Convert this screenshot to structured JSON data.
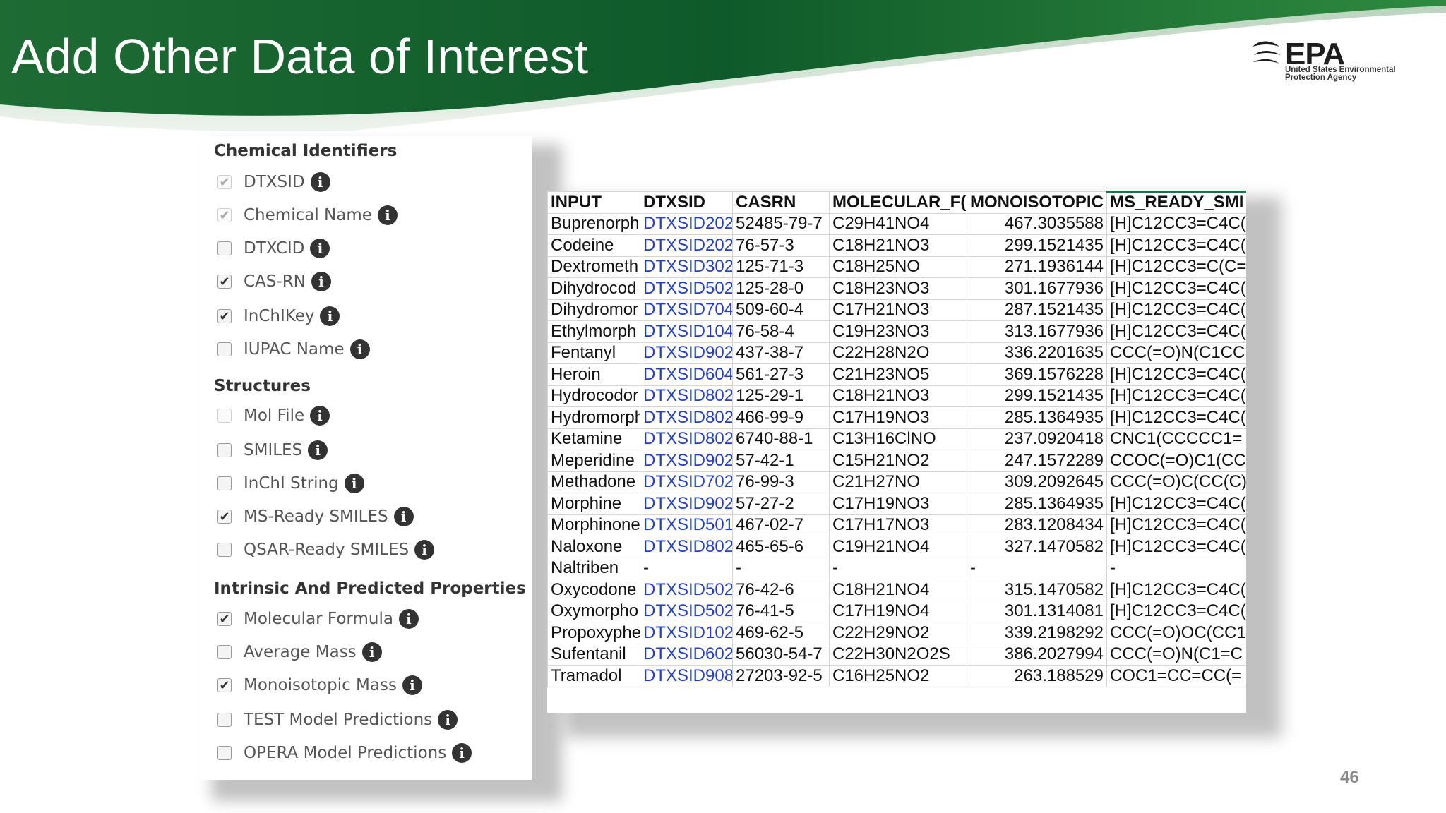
{
  "slide": {
    "title": "Add Other Data of Interest",
    "page_number": "46"
  },
  "logo": {
    "text": "EPA",
    "subtitle": "United States Environmental Protection Agency"
  },
  "panel": {
    "sections": [
      {
        "header": "Chemical Identifiers",
        "options": [
          {
            "label": "DTXSID",
            "checked": true,
            "disabled": true
          },
          {
            "label": "Chemical Name",
            "checked": true,
            "disabled": true
          },
          {
            "label": "DTXCID",
            "checked": false,
            "disabled": false
          },
          {
            "label": "CAS-RN",
            "checked": true,
            "disabled": false
          },
          {
            "label": "InChIKey",
            "checked": true,
            "disabled": false
          },
          {
            "label": "IUPAC Name",
            "checked": false,
            "disabled": false
          }
        ]
      },
      {
        "header": "Structures",
        "options": [
          {
            "label": "Mol File",
            "checked": false,
            "disabled": true
          },
          {
            "label": "SMILES",
            "checked": false,
            "disabled": false
          },
          {
            "label": "InChI String",
            "checked": false,
            "disabled": false
          },
          {
            "label": "MS-Ready SMILES",
            "checked": true,
            "disabled": false
          },
          {
            "label": "QSAR-Ready SMILES",
            "checked": false,
            "disabled": false
          }
        ]
      },
      {
        "header": "Intrinsic And Predicted Properties",
        "options": [
          {
            "label": "Molecular Formula",
            "checked": true,
            "disabled": false
          },
          {
            "label": "Average Mass",
            "checked": false,
            "disabled": false
          },
          {
            "label": "Monoisotopic Mass",
            "checked": true,
            "disabled": false
          },
          {
            "label": "TEST Model Predictions",
            "checked": false,
            "disabled": false
          },
          {
            "label": "OPERA Model Predictions",
            "checked": false,
            "disabled": false
          }
        ]
      }
    ]
  },
  "sheet": {
    "headers": [
      "INPUT",
      "DTXSID",
      "CASRN",
      "MOLECULAR_F(",
      "MONOISOTOPIC",
      "MS_READY_SMI"
    ],
    "rows": [
      [
        "Buprenorph",
        "DTXSID202",
        "52485-79-7",
        "C29H41NO4",
        "467.3035588",
        "[H]C12CC3=C4C("
      ],
      [
        "Codeine",
        "DTXSID202(",
        "76-57-3",
        "C18H21NO3",
        "299.1521435",
        "[H]C12CC3=C4C("
      ],
      [
        "Dextrometh",
        "DTXSID302",
        "125-71-3",
        "C18H25NO",
        "271.1936144",
        "[H]C12CC3=C(C="
      ],
      [
        "Dihydrocod",
        "DTXSID502",
        "125-28-0",
        "C18H23NO3",
        "301.1677936",
        "[H]C12CC3=C4C("
      ],
      [
        "Dihydromor",
        "DTXSID704",
        "509-60-4",
        "C17H21NO3",
        "287.1521435",
        "[H]C12CC3=C4C("
      ],
      [
        "Ethylmorph",
        "DTXSID104",
        "76-58-4",
        "C19H23NO3",
        "313.1677936",
        "[H]C12CC3=C4C("
      ],
      [
        "Fentanyl",
        "DTXSID902",
        "437-38-7",
        "C22H28N2O",
        "336.2201635",
        "CCC(=O)N(C1CC"
      ],
      [
        "Heroin",
        "DTXSID604",
        "561-27-3",
        "C21H23NO5",
        "369.1576228",
        "[H]C12CC3=C4C("
      ],
      [
        "Hydrocodor",
        "DTXSID802",
        "125-29-1",
        "C18H21NO3",
        "299.1521435",
        "[H]C12CC3=C4C("
      ],
      [
        "Hydromorph",
        "DTXSID802",
        "466-99-9",
        "C17H19NO3",
        "285.1364935",
        "[H]C12CC3=C4C("
      ],
      [
        "Ketamine",
        "DTXSID802",
        "6740-88-1",
        "C13H16ClNO",
        "237.0920418",
        "CNC1(CCCCC1="
      ],
      [
        "Meperidine",
        "DTXSID902",
        "57-42-1",
        "C15H21NO2",
        "247.1572289",
        "CCOC(=O)C1(CC"
      ],
      [
        "Methadone",
        "DTXSID702",
        "76-99-3",
        "C21H27NO",
        "309.2092645",
        "CCC(=O)C(CC(C)"
      ],
      [
        "Morphine",
        "DTXSID902",
        "57-27-2",
        "C17H19NO3",
        "285.1364935",
        "[H]C12CC3=C4C("
      ],
      [
        "Morphinone",
        "DTXSID501",
        "467-02-7",
        "C17H17NO3",
        "283.1208434",
        "[H]C12CC3=C4C("
      ],
      [
        "Naloxone",
        "DTXSID802",
        "465-65-6",
        "C19H21NO4",
        "327.1470582",
        "[H]C12CC3=C4C("
      ],
      [
        "Naltriben",
        "-",
        "-",
        "-",
        "-",
        "-"
      ],
      [
        "Oxycodone",
        "DTXSID502",
        "76-42-6",
        "C18H21NO4",
        "315.1470582",
        "[H]C12CC3=C4C("
      ],
      [
        "Oxymorpho",
        "DTXSID502",
        "76-41-5",
        "C17H19NO4",
        "301.1314081",
        "[H]C12CC3=C4C("
      ],
      [
        "Propoxyphe",
        "DTXSID102",
        "469-62-5",
        "C22H29NO2",
        "339.2198292",
        "CCC(=O)OC(CC1"
      ],
      [
        "Sufentanil",
        "DTXSID602",
        "56030-54-7",
        "C22H30N2O2S",
        "386.2027994",
        "CCC(=O)N(C1=C"
      ],
      [
        "Tramadol",
        "DTXSID908",
        "27203-92-5",
        "C16H25NO2",
        "263.188529",
        "COC1=CC=CC(="
      ]
    ]
  }
}
